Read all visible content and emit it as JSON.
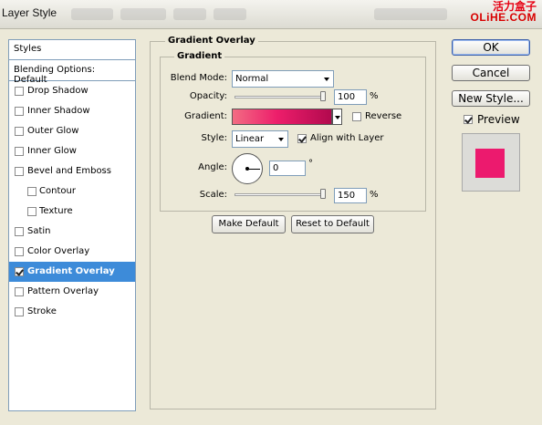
{
  "window": {
    "title": "Layer Style"
  },
  "watermark": {
    "line1": "活力盒子",
    "line2": "OLiHE.COM"
  },
  "sidebar": {
    "header": "Styles",
    "blending_options": "Blending Options: Default",
    "items": [
      {
        "label": "Drop Shadow",
        "checked": false
      },
      {
        "label": "Inner Shadow",
        "checked": false
      },
      {
        "label": "Outer Glow",
        "checked": false
      },
      {
        "label": "Inner Glow",
        "checked": false
      },
      {
        "label": "Bevel and Emboss",
        "checked": false
      },
      {
        "label": "Contour",
        "checked": false
      },
      {
        "label": "Texture",
        "checked": false
      },
      {
        "label": "Satin",
        "checked": false
      },
      {
        "label": "Color Overlay",
        "checked": false
      },
      {
        "label": "Gradient Overlay",
        "checked": true
      },
      {
        "label": "Pattern Overlay",
        "checked": false
      },
      {
        "label": "Stroke",
        "checked": false
      }
    ]
  },
  "gradient_overlay": {
    "section_title": "Gradient Overlay",
    "group_title": "Gradient",
    "blend_mode": {
      "label": "Blend Mode:",
      "value": "Normal"
    },
    "opacity": {
      "label": "Opacity:",
      "value": "100",
      "unit": "%"
    },
    "gradient": {
      "label": "Gradient:",
      "colors": [
        "#f26c83",
        "#ed1e6b",
        "#b2094e"
      ],
      "reverse_label": "Reverse",
      "reverse_checked": false
    },
    "style": {
      "label": "Style:",
      "value": "Linear",
      "align_label": "Align with Layer",
      "align_checked": true
    },
    "angle": {
      "label": "Angle:",
      "value": "0",
      "unit": "°"
    },
    "scale": {
      "label": "Scale:",
      "value": "150",
      "unit": "%"
    },
    "make_default": "Make Default",
    "reset_default": "Reset to Default"
  },
  "actions": {
    "ok": "OK",
    "cancel": "Cancel",
    "new_style": "New Style...",
    "preview_label": "Preview",
    "preview_checked": true,
    "preview_color": "#ec1a6e"
  }
}
